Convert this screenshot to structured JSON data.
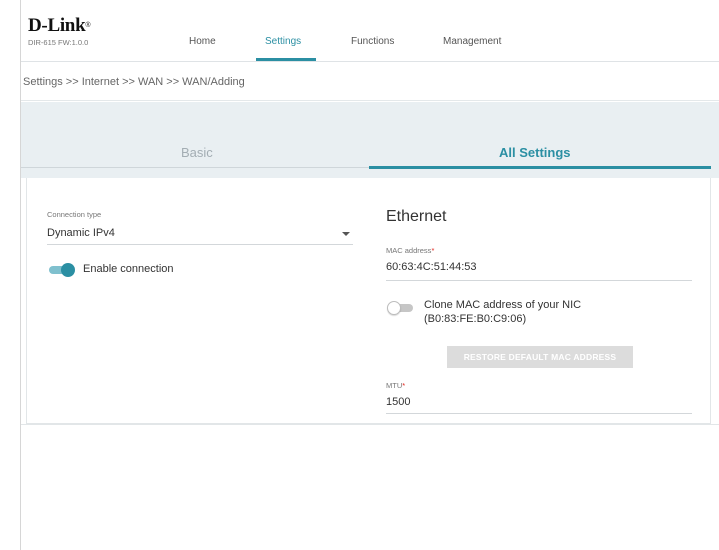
{
  "header": {
    "brand": "D-Link",
    "brand_mark": "®",
    "model": "DIR-615 FW:1.0.0",
    "nav": [
      "Home",
      "Settings",
      "Functions",
      "Management"
    ],
    "active_nav": "Settings"
  },
  "breadcrumb": "Settings >> Internet >> WAN >> WAN/Adding",
  "tabs": {
    "basic": "Basic",
    "all": "All Settings",
    "active": "All Settings"
  },
  "connection": {
    "type_label": "Connection type",
    "type_value": "Dynamic IPv4",
    "enable_label": "Enable connection",
    "enable_on": true
  },
  "ethernet": {
    "title": "Ethernet",
    "mac_label": "MAC address",
    "mac_required": "*",
    "mac_value": "60:63:4C:51:44:53",
    "clone_label": "Clone MAC address of your NIC",
    "clone_mac": "(B0:83:FE:B0:C9:06)",
    "clone_on": false,
    "restore_button": "RESTORE DEFAULT MAC ADDRESS",
    "mtu_label": "MTU",
    "mtu_required": "*",
    "mtu_value": "1500"
  },
  "colors": {
    "accent": "#2b8fa3",
    "band": "#e9eff2",
    "required": "#e2231a"
  }
}
